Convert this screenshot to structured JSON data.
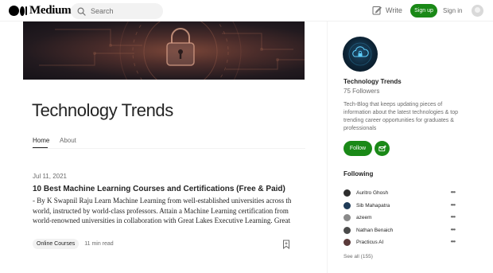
{
  "header": {
    "brand": "Medium",
    "search_placeholder": "Search",
    "write_label": "Write",
    "signup_label": "Sign up",
    "signin_label": "Sign in"
  },
  "publication": {
    "title": "Technology Trends",
    "tabs": [
      {
        "label": "Home",
        "active": true
      },
      {
        "label": "About",
        "active": false
      }
    ]
  },
  "post": {
    "date": "Jul 11, 2021",
    "title": "10 Best Machine Learning Courses and Certifications (Free & Paid)",
    "excerpt_lines": [
      "- By K Swapnil Raju Learn Machine Learning from well-established universities across the",
      "world, instructed by world-class professors. Attain a Machine Learning certification from",
      "world-renowned universities in collaboration with Great Lakes Executive Learning. Great…"
    ],
    "tag": "Online Courses",
    "read_time": "11 min read"
  },
  "sidebar": {
    "name": "Technology Trends",
    "followers": "75 Followers",
    "description": "Tech-Blog that keeps updating pieces of information about the latest technologies & top trending career opportunities for graduates & professionals",
    "follow_label": "Follow",
    "following_title": "Following",
    "following": [
      {
        "name": "Auritro Ghosh"
      },
      {
        "name": "Sib Mahapatra"
      },
      {
        "name": "azeem"
      },
      {
        "name": "Nathan Benaich"
      },
      {
        "name": "Practicus AI"
      }
    ],
    "see_all": "See all (155)"
  },
  "colors": {
    "accent_green": "#1a8917",
    "text_primary": "#242424",
    "text_secondary": "#6b6b6b"
  }
}
